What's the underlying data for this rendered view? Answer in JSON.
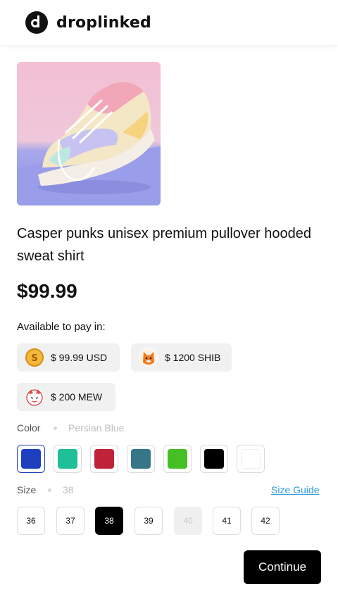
{
  "header": {
    "brand": "droplinked"
  },
  "product": {
    "title": "Casper punks unisex premium pullover hooded sweat shirt",
    "price": "$99.99",
    "image_icon": "sneaker-photo"
  },
  "payment": {
    "label": "Available to pay in:",
    "options": [
      {
        "text": "$ 99.99 USD",
        "icon": "dollar-coin-icon"
      },
      {
        "text": "$ 1200 SHIB",
        "icon": "shiba-token-icon"
      },
      {
        "text": "$ 200 MEW",
        "icon": "mew-cat-token-icon"
      }
    ]
  },
  "color": {
    "label": "Color",
    "selected": "Persian Blue",
    "swatches": [
      "#1e3fbf",
      "#1fbf98",
      "#c0223a",
      "#367688",
      "#46bf24",
      "#000000",
      "#ffffff"
    ]
  },
  "size": {
    "label": "Size",
    "selected": "38",
    "guide": "Size Guide",
    "options": [
      "36",
      "37",
      "38",
      "39",
      "40",
      "41",
      "42"
    ],
    "disabled": [
      "40"
    ]
  },
  "actions": {
    "continue": "Continue"
  }
}
